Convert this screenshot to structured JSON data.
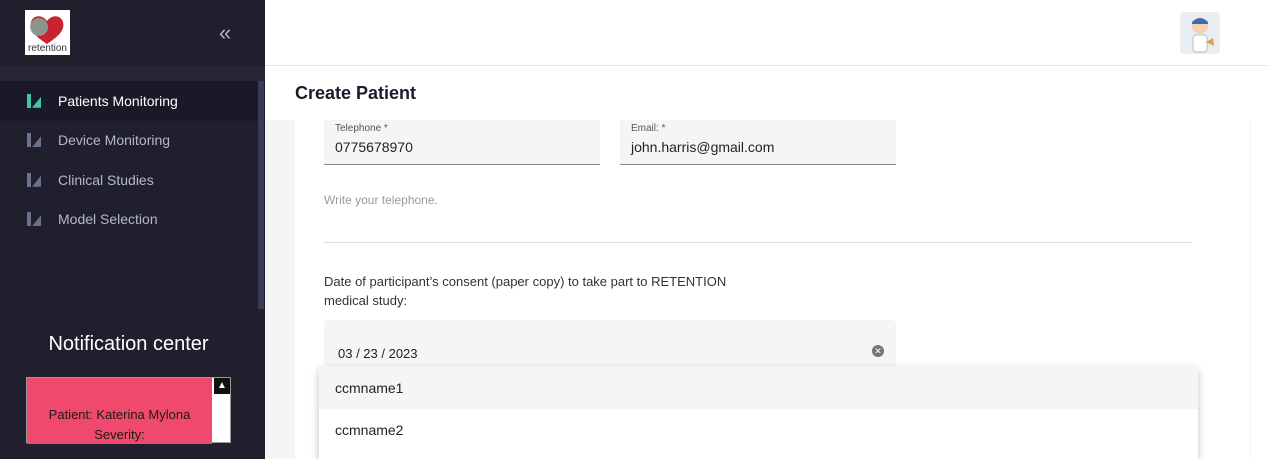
{
  "sidebar": {
    "logo_text": "retention",
    "collapse_glyph": "«",
    "items": [
      {
        "label": "Patients Monitoring",
        "icon": "chart-icon",
        "active": true
      },
      {
        "label": "Device Monitoring",
        "icon": "chart-icon",
        "active": false
      },
      {
        "label": "Clinical Studies",
        "icon": "chart-icon",
        "active": false
      },
      {
        "label": "Model Selection",
        "icon": "chart-icon",
        "active": false
      }
    ],
    "notification": {
      "title": "Notification center",
      "card_line1": "Patient: Katerina Mylona",
      "card_line2": "Severity:",
      "color": "#ef4a6d"
    }
  },
  "page": {
    "title": "Create Patient"
  },
  "form": {
    "telephone": {
      "label": "Telephone *",
      "value": "0775678970"
    },
    "email": {
      "label": "Email: *",
      "value": "john.harris@gmail.com"
    },
    "telephone_helper": "Write your telephone.",
    "consent_label": "Date of participant’s consent (paper copy) to take part to RETENTION medical study:",
    "consent_date": "03 / 23 / 2023"
  },
  "dropdown": {
    "options": [
      "ccmname1",
      "ccmname2"
    ]
  },
  "colors": {
    "sidebar_bg": "#1f1f2e",
    "accent": "#40c4b0"
  }
}
